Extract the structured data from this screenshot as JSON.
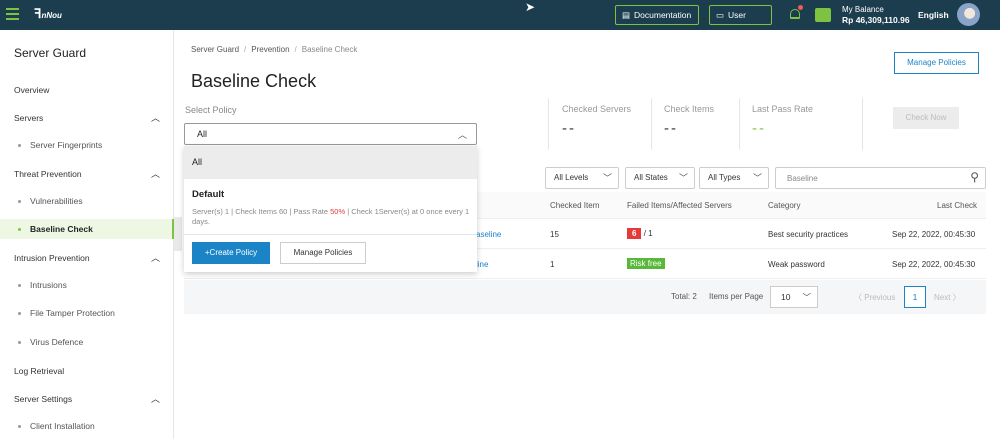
{
  "topbar": {
    "logo_text": "nNou",
    "documentation_label": "Documentation",
    "user_center_label": "User Center",
    "balance_label": "My Balance",
    "balance_amount": "Rp 46,309,110.96",
    "language": "English"
  },
  "sidebar": {
    "title": "Server Guard",
    "items": [
      {
        "label": "Overview"
      },
      {
        "label": "Servers"
      },
      {
        "label": "Server Fingerprints"
      },
      {
        "label": "Threat Prevention"
      },
      {
        "label": "Vulnerabilities"
      },
      {
        "label": "Baseline Check"
      },
      {
        "label": "Intrusion Prevention"
      },
      {
        "label": "Intrusions"
      },
      {
        "label": "File Tamper Protection"
      },
      {
        "label": "Virus Defence"
      },
      {
        "label": "Log Retrieval"
      },
      {
        "label": "Server Settings"
      },
      {
        "label": "Client Installation"
      }
    ]
  },
  "breadcrumb": [
    "Server Guard",
    "Prevention",
    "Baseline Check"
  ],
  "page": {
    "title": "Baseline Check",
    "manage_policies_label": "Manage Policies",
    "select_policy_label": "Select Policy",
    "selected_policy": "All"
  },
  "stats": [
    {
      "label": "Checked Servers",
      "value": "--"
    },
    {
      "label": "Check Items",
      "value": "--"
    },
    {
      "label": "Last Pass Rate",
      "value": "--"
    }
  ],
  "check_now_label": "Check Now",
  "filters": {
    "levels": "All Levels",
    "states": "All States",
    "types": "All Types",
    "search_placeholder": "Baseline"
  },
  "table": {
    "headers": [
      "Checked Item",
      "Failed Items/Affected Servers",
      "Category",
      "Last Check"
    ],
    "rows": [
      {
        "name_fragment": "aseline",
        "checked": "15",
        "failed": "6",
        "affected": "/ 1",
        "category": "Best security practices",
        "last_check": "Sep 22, 2022, 00:45:30"
      },
      {
        "name_fragment": "line",
        "checked": "1",
        "status": "Risk free",
        "category": "Weak password",
        "last_check": "Sep 22, 2022, 00:45:30"
      }
    ]
  },
  "pagination": {
    "total": "Total: 2",
    "items_per_page_label": "Items per Page",
    "page_size": "10",
    "prev_label": "Previous",
    "current_page": "1",
    "next_label": "Next"
  },
  "dropdown": {
    "option_all": "All",
    "policy_name": "Default",
    "desc_part1": "Server(s) 1 | Check Items 60 | Pass Rate ",
    "pass_rate": "50%",
    "desc_part2": " | Check    1Server(s) at 0 once every 1 days.",
    "create_label": "+Create Policy",
    "manage_label": "Manage Policies"
  },
  "colors": {
    "topbar_bg": "#1c3d4e",
    "accent_green": "#7ec242",
    "link_blue": "#1a84c7",
    "danger_red": "#e53a3a"
  }
}
